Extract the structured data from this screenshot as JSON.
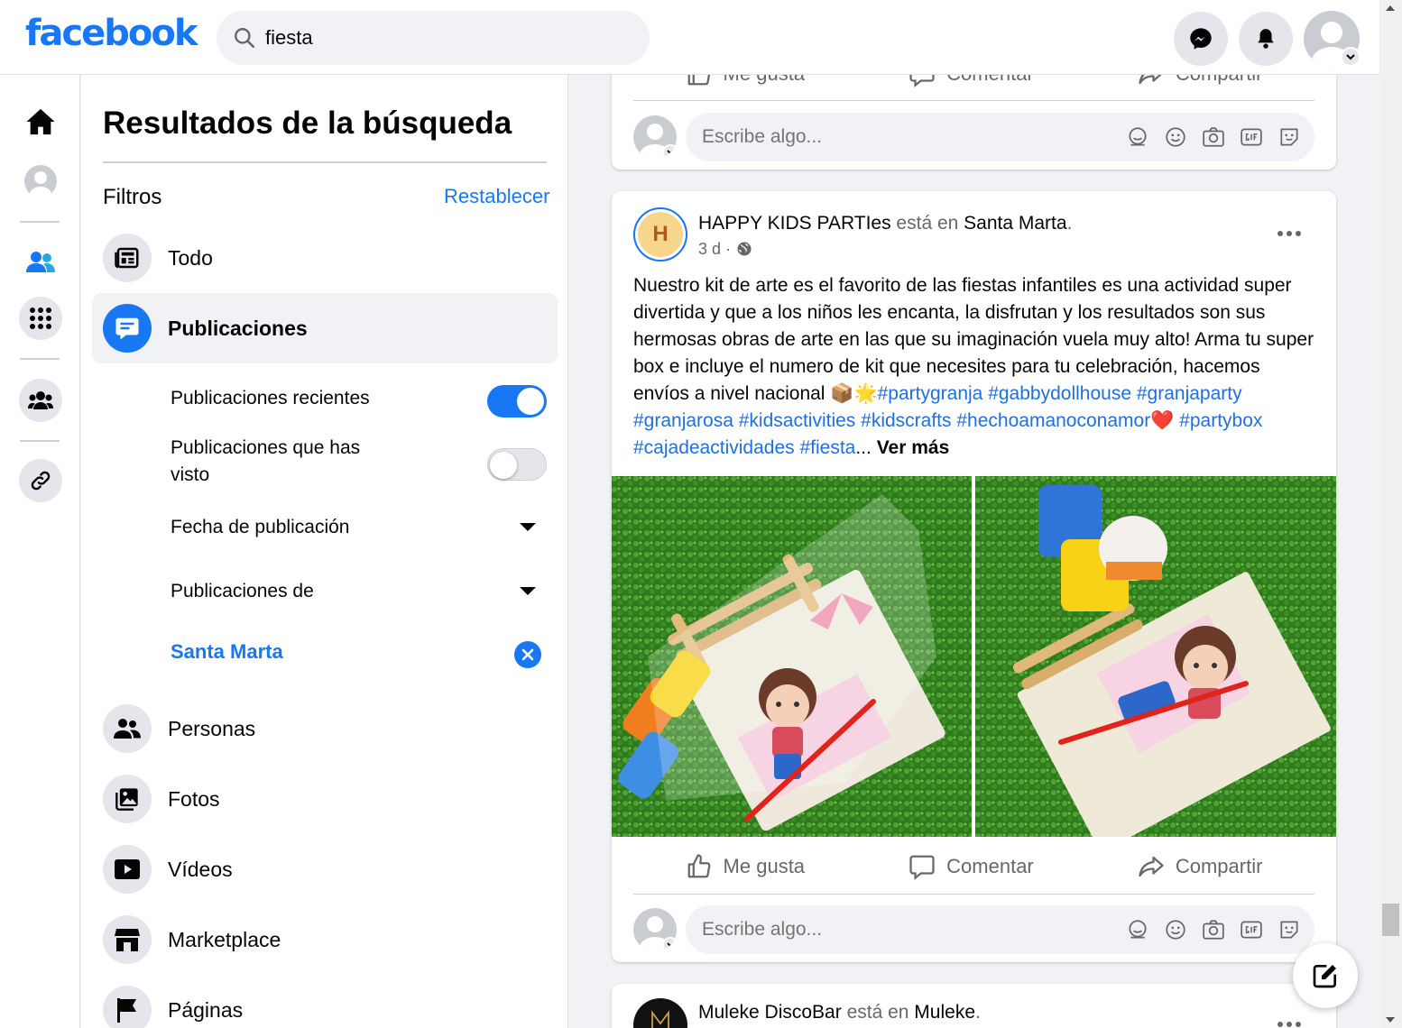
{
  "header": {
    "logo": "facebook",
    "search_value": "fiesta"
  },
  "panel": {
    "title": "Resultados de la búsqueda",
    "filters_label": "Filtros",
    "reset_label": "Restablecer",
    "categories": [
      {
        "label": "Todo",
        "icon": "newsfeed-icon"
      },
      {
        "label": "Publicaciones",
        "icon": "posts-icon",
        "active": true
      },
      {
        "label": "Personas",
        "icon": "people-icon"
      },
      {
        "label": "Fotos",
        "icon": "photos-icon"
      },
      {
        "label": "Vídeos",
        "icon": "video-icon"
      },
      {
        "label": "Marketplace",
        "icon": "marketplace-icon"
      },
      {
        "label": "Páginas",
        "icon": "flag-icon"
      }
    ],
    "sub_filters": {
      "recent_label": "Publicaciones recientes",
      "recent_on": true,
      "seen_label_1": "Publicaciones que has",
      "seen_label_2": "visto",
      "seen_on": false,
      "date_label": "Fecha de publicación",
      "from_label": "Publicaciones de",
      "location_value": "Santa Marta"
    }
  },
  "actions": {
    "like": "Me gusta",
    "comment": "Comentar",
    "share": "Compartir",
    "comment_placeholder": "Escribe algo..."
  },
  "post": {
    "avatar_letter": "H",
    "author": "HAPPY KIDS PARTIes",
    "is_at": " está en ",
    "location": "Santa Marta",
    "period": ".",
    "time": "3 d ·",
    "text_1": "Nuestro kit de arte es el favorito de las fiestas infantiles es una actividad super divertida y que a los niños les encanta, la disfrutan y los resultados son sus hermosas obras de arte en las que su imaginación vuela muy alto! Arma tu super box e incluye el numero de kit que necesites para tu celebración, hacemos envíos a nivel nacional 📦🌟",
    "tag_1": "#partygranja",
    "tag_2": "#gabbydollhouse",
    "tag_3": "#granjaparty",
    "tag_4": "#granjarosa",
    "tag_5": "#kidsactivities",
    "tag_6": "#kidscrafts",
    "tag_7": "#hechoamanoconamor",
    "heart": "❤️",
    "tag_8": "#partybox",
    "tag_9": "#cajadeactividades",
    "tag_10": "#fiesta",
    "ellipsis": "...",
    "see_more": "Ver más"
  },
  "next_post": {
    "author": "Muleke DiscoBar",
    "is_at": " está en ",
    "location": "Muleke",
    "period": "."
  },
  "colors": {
    "brand": "#1877f2",
    "background": "#f0f2f5",
    "hashtag": "#216fdb"
  }
}
